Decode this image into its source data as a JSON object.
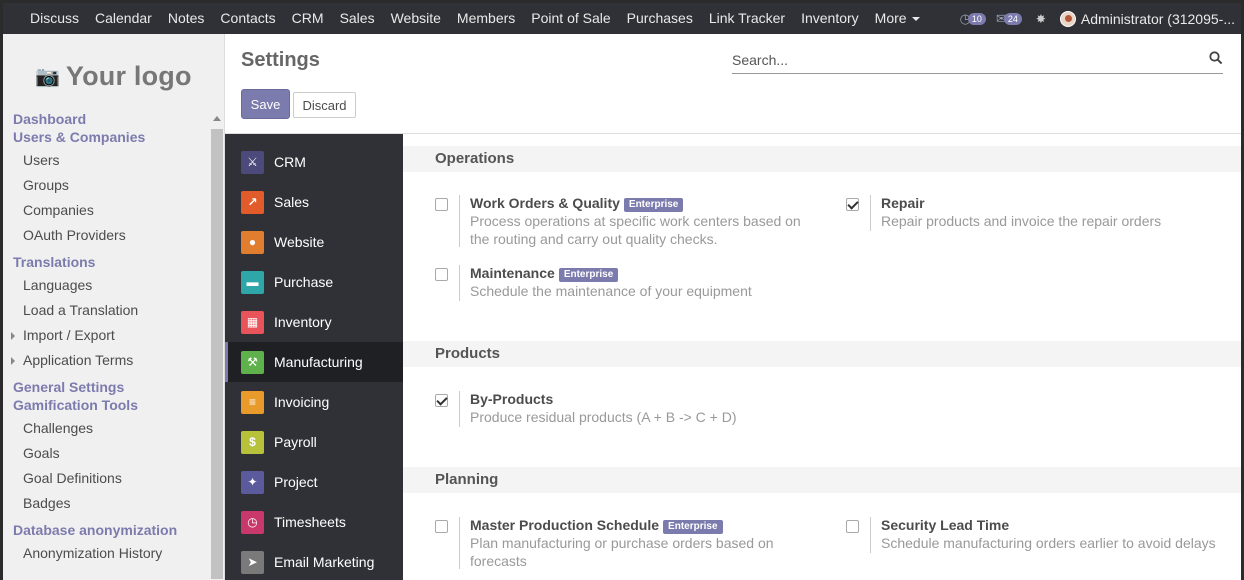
{
  "topbar": {
    "menu": [
      "Discuss",
      "Calendar",
      "Notes",
      "Contacts",
      "CRM",
      "Sales",
      "Website",
      "Members",
      "Point of Sale",
      "Purchases",
      "Link Tracker",
      "Inventory",
      "More"
    ],
    "activities_count": "10",
    "messages_count": "24",
    "user": "Administrator (312095-..."
  },
  "sidebar": {
    "logo_text": "Your logo",
    "groups": [
      {
        "head": "Dashboard",
        "items": []
      },
      {
        "head": "Users & Companies",
        "items": [
          {
            "label": "Users",
            "expandable": false
          },
          {
            "label": "Groups",
            "expandable": false
          },
          {
            "label": "Companies",
            "expandable": false
          },
          {
            "label": "OAuth Providers",
            "expandable": false
          }
        ]
      },
      {
        "head": "Translations",
        "items": [
          {
            "label": "Languages",
            "expandable": false
          },
          {
            "label": "Load a Translation",
            "expandable": false
          },
          {
            "label": "Import / Export",
            "expandable": true
          },
          {
            "label": "Application Terms",
            "expandable": true
          }
        ]
      },
      {
        "head": "General Settings",
        "items": []
      },
      {
        "head": "Gamification Tools",
        "items": [
          {
            "label": "Challenges",
            "expandable": false
          },
          {
            "label": "Goals",
            "expandable": false
          },
          {
            "label": "Goal Definitions",
            "expandable": false
          },
          {
            "label": "Badges",
            "expandable": false
          }
        ]
      },
      {
        "head": "Database anonymization",
        "items": [
          {
            "label": "Anonymization History",
            "expandable": false
          }
        ]
      }
    ]
  },
  "control_panel": {
    "title": "Settings",
    "save_label": "Save",
    "discard_label": "Discard",
    "search_placeholder": "Search..."
  },
  "apps": [
    {
      "label": "CRM",
      "icon": "handshake-icon",
      "color": "#4b4a7a",
      "glyph": "⚔",
      "active": false
    },
    {
      "label": "Sales",
      "icon": "chart-icon",
      "color": "#e25b2b",
      "glyph": "↗",
      "active": false
    },
    {
      "label": "Website",
      "icon": "globe-icon",
      "color": "#e07d2f",
      "glyph": "●",
      "active": false
    },
    {
      "label": "Purchase",
      "icon": "card-icon",
      "color": "#2fa6a7",
      "glyph": "▬",
      "active": false
    },
    {
      "label": "Inventory",
      "icon": "box-icon",
      "color": "#e9545a",
      "glyph": "▦",
      "active": false
    },
    {
      "label": "Manufacturing",
      "icon": "wrench-icon",
      "color": "#5fb14b",
      "glyph": "⚒",
      "active": true
    },
    {
      "label": "Invoicing",
      "icon": "invoice-icon",
      "color": "#e89b2a",
      "glyph": "≡",
      "active": false
    },
    {
      "label": "Payroll",
      "icon": "money-icon",
      "color": "#b7c23a",
      "glyph": "$",
      "active": false
    },
    {
      "label": "Project",
      "icon": "puzzle-icon",
      "color": "#5a5a9c",
      "glyph": "✦",
      "active": false
    },
    {
      "label": "Timesheets",
      "icon": "clock-icon",
      "color": "#c9386a",
      "glyph": "◷",
      "active": false
    },
    {
      "label": "Email Marketing",
      "icon": "paper-plane-icon",
      "color": "#7a7a7a",
      "glyph": "➤",
      "active": false
    }
  ],
  "sections": {
    "operations": {
      "title": "Operations",
      "work_orders": {
        "name": "Work Orders & Quality",
        "badge": "Enterprise",
        "desc": "Process operations at specific work centers based on the routing and carry out quality checks.",
        "checked": false
      },
      "repair": {
        "name": "Repair",
        "desc": "Repair products and invoice the repair orders",
        "checked": true
      },
      "maintenance": {
        "name": "Maintenance",
        "badge": "Enterprise",
        "desc": "Schedule the maintenance of your equipment",
        "checked": false
      }
    },
    "products": {
      "title": "Products",
      "by_products": {
        "name": "By-Products",
        "desc": "Produce residual products (A + B -> C + D)",
        "checked": true
      }
    },
    "planning": {
      "title": "Planning",
      "mps": {
        "name": "Master Production Schedule",
        "badge": "Enterprise",
        "desc": "Plan manufacturing or purchase orders based on forecasts",
        "checked": false
      },
      "security_lead_time": {
        "name": "Security Lead Time",
        "desc": "Schedule manufacturing orders earlier to avoid delays",
        "checked": false
      }
    }
  }
}
